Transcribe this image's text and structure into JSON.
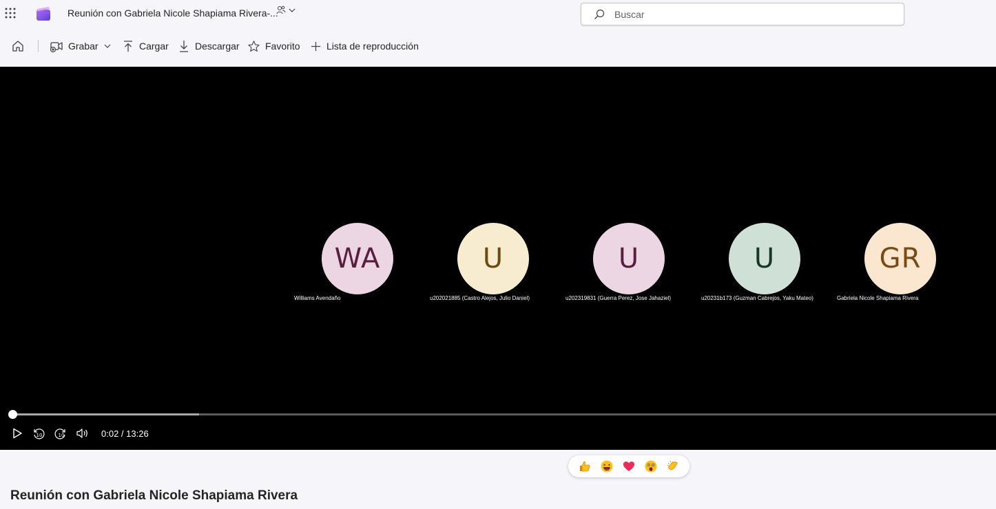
{
  "header": {
    "doc_title": "Reunión con Gabriela Nicole Shapiama Rivera-...",
    "share_icon": "people-icon",
    "search_placeholder": "Buscar"
  },
  "toolbar": {
    "record_label": "Grabar",
    "upload_label": "Cargar",
    "download_label": "Descargar",
    "favorite_label": "Favorito",
    "playlist_label": "Lista de reproducción"
  },
  "video": {
    "participants": [
      {
        "initials": "WA",
        "name": "Williams Avendaño",
        "bg": "#ecd6e4",
        "fg": "#5a1f3f"
      },
      {
        "initials": "U",
        "name": "u202021885 (Castro Alejos, Julio Daniel)",
        "bg": "#f7ebd0",
        "fg": "#6b4a0e"
      },
      {
        "initials": "U",
        "name": "u202319831 (Guerra Perez, Jose Jahaziel)",
        "bg": "#ecd6e4",
        "fg": "#5a1f3f"
      },
      {
        "initials": "U",
        "name": "u20231b173 (Guzman Cabrejos, Yaku Mateo)",
        "bg": "#cfe1d6",
        "fg": "#163825"
      },
      {
        "initials": "GR",
        "name": "Gabriela Nicole Shapiama Rivera",
        "bg": "#fbe7d0",
        "fg": "#7a4a14"
      }
    ],
    "time_display": "0:02 / 13:26",
    "buffered_fraction": 0.19,
    "played_fraction": 0.0025
  },
  "reactions": [
    "thumbs-up-icon",
    "laugh-icon",
    "heart-icon",
    "surprised-icon",
    "applause-icon"
  ],
  "page_title": "Reunión con Gabriela Nicole Shapiama Rivera",
  "colors": {
    "accent": "#7b5cf5",
    "video_bg": "#000000",
    "page_bg": "#f5f5fa"
  }
}
